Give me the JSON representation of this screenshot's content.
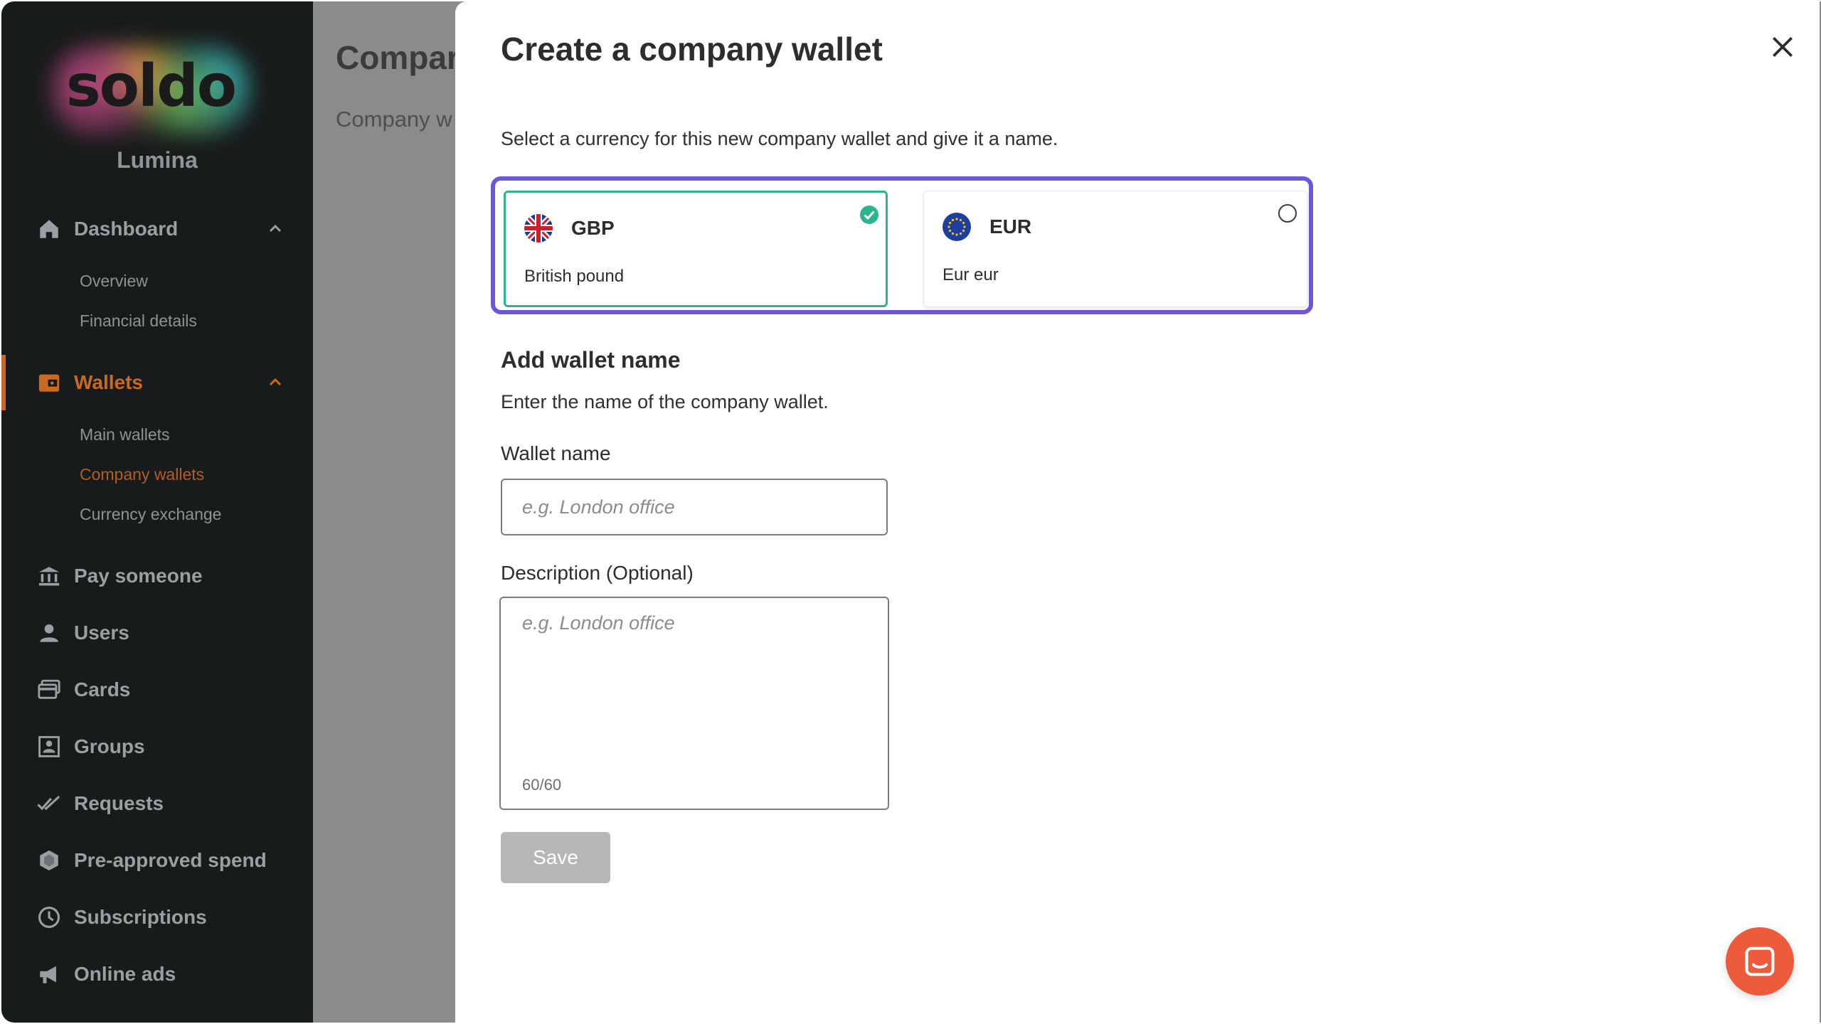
{
  "brand": {
    "logo_text": "soldo",
    "company_name": "Lumina"
  },
  "sidebar": {
    "dashboard": {
      "label": "Dashboard",
      "icon": "home-icon",
      "items": [
        "Overview",
        "Financial details"
      ]
    },
    "wallets": {
      "label": "Wallets",
      "icon": "wallet-icon",
      "items": [
        "Main wallets",
        "Company wallets",
        "Currency exchange"
      ],
      "active_item": "Company wallets"
    },
    "nav": [
      {
        "label": "Pay someone",
        "icon": "bank-icon"
      },
      {
        "label": "Users",
        "icon": "user-icon"
      },
      {
        "label": "Cards",
        "icon": "cards-icon"
      },
      {
        "label": "Groups",
        "icon": "groups-icon"
      },
      {
        "label": "Requests",
        "icon": "double-check-icon"
      },
      {
        "label": "Pre-approved spend",
        "icon": "hexagon-icon"
      },
      {
        "label": "Subscriptions",
        "icon": "clock-icon"
      },
      {
        "label": "Online ads",
        "icon": "megaphone-icon"
      }
    ]
  },
  "background_page": {
    "title": "Compar",
    "subtitle": "Company w"
  },
  "modal": {
    "title": "Create a company wallet",
    "intro": "Select a currency for this new company wallet and give it a name.",
    "currencies": [
      {
        "code": "GBP",
        "name": "British pound",
        "selected": true,
        "icon": "uk-flag-icon"
      },
      {
        "code": "EUR",
        "name": "Eur eur",
        "selected": false,
        "icon": "eu-flag-icon"
      }
    ],
    "section_title": "Add wallet name",
    "section_desc": "Enter the name of the company wallet.",
    "wallet_name_label": "Wallet name",
    "wallet_name_placeholder": "e.g. London office",
    "wallet_name_value": "",
    "description_label": "Description  (Optional)",
    "description_placeholder": "e.g. London office",
    "description_value": "",
    "char_count": "60/60",
    "save_label": "Save"
  },
  "colors": {
    "sidebar_bg": "#181b1b",
    "active_accent": "#c86a23",
    "selection_outline": "#6e56d8",
    "selected_card_border": "#2bb58f",
    "chat_button": "#ee5a3c",
    "save_disabled": "#b4b6b7"
  }
}
